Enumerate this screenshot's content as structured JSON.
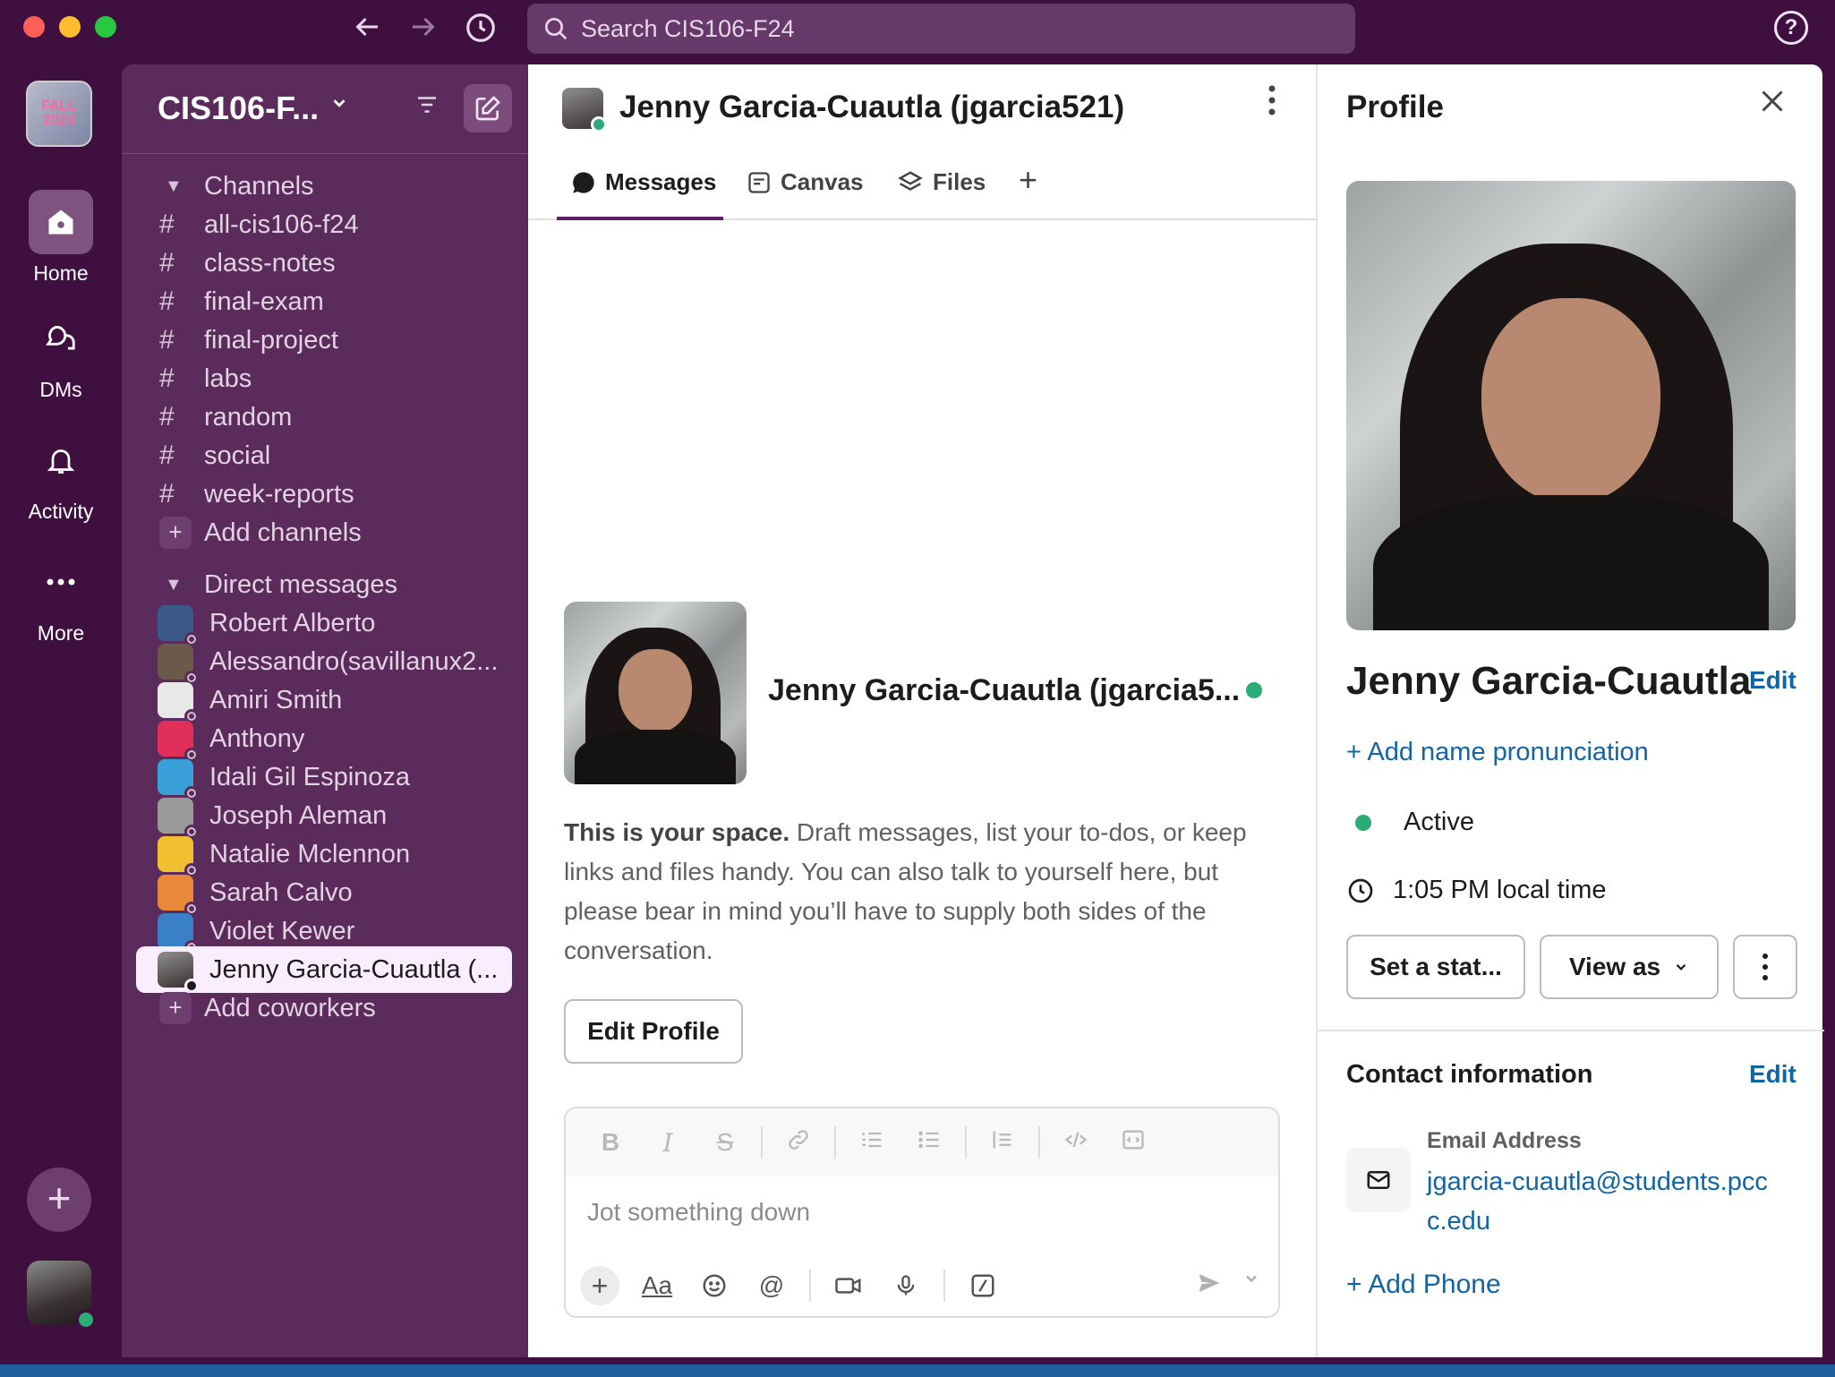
{
  "colors": {
    "brand": "#3f0f40",
    "sidebar": "#5b2b5c",
    "link": "#1264a3",
    "active_status": "#2bac76"
  },
  "search": {
    "placeholder": "Search CIS106-F24"
  },
  "rail": {
    "workspace_logo_text": "FALL 2024",
    "items": [
      {
        "label": "Home",
        "icon": "home-icon"
      },
      {
        "label": "DMs",
        "icon": "dms-icon"
      },
      {
        "label": "Activity",
        "icon": "bell-icon"
      },
      {
        "label": "More",
        "icon": "more-icon"
      }
    ]
  },
  "sidebar": {
    "workspace_name": "CIS106-F...",
    "channels_header": "Channels",
    "channels": [
      "all-cis106-f24",
      "class-notes",
      "final-exam",
      "final-project",
      "labs",
      "random",
      "social",
      "week-reports"
    ],
    "add_channels": "Add channels",
    "dm_header": "Direct messages",
    "dms": [
      {
        "name": "Robert Alberto",
        "color": "#3b5a8a"
      },
      {
        "name": "Alessandro(savillanux2...",
        "color": "#6b5a4a"
      },
      {
        "name": "Amiri Smith",
        "color": "#e8e8e8"
      },
      {
        "name": "Anthony",
        "color": "#e0305a"
      },
      {
        "name": "Idali Gil Espinoza",
        "color": "#3aa0d8"
      },
      {
        "name": "Joseph Aleman",
        "color": "#9a9a9a"
      },
      {
        "name": "Natalie Mclennon",
        "color": "#f0c030"
      },
      {
        "name": "Sarah Calvo",
        "color": "#e8883a"
      },
      {
        "name": "Violet Kewer",
        "color": "#3a80c8"
      }
    ],
    "active_dm": "Jenny Garcia-Cuautla (...",
    "add_coworkers": "Add coworkers"
  },
  "main": {
    "title": "Jenny Garcia-Cuautla (jgarcia521)",
    "tabs": {
      "messages": "Messages",
      "canvas": "Canvas",
      "files": "Files"
    },
    "intro_name": "Jenny Garcia-Cuautla (jgarcia5...",
    "intro_bold": "This is your space.",
    "intro_text": " Draft messages, list your to-dos, or keep links and files handy. You can also talk to yourself here, but please bear in mind you’ll have to supply both sides of the conversation.",
    "edit_profile": "Edit Profile",
    "composer_placeholder": "Jot something down"
  },
  "profile": {
    "title": "Profile",
    "name": "Jenny Garcia-Cuautla",
    "edit": "Edit",
    "add_pronunciation": "+ Add name pronunciation",
    "status": "Active",
    "local_time": "1:05 PM local time",
    "set_status": "Set a stat...",
    "view_as": "View as",
    "contact_title": "Contact information",
    "contact_edit": "Edit",
    "email_label": "Email Address",
    "email": "jgarcia-cuautla@students.pccc.edu",
    "add_phone": "+ Add Phone"
  }
}
